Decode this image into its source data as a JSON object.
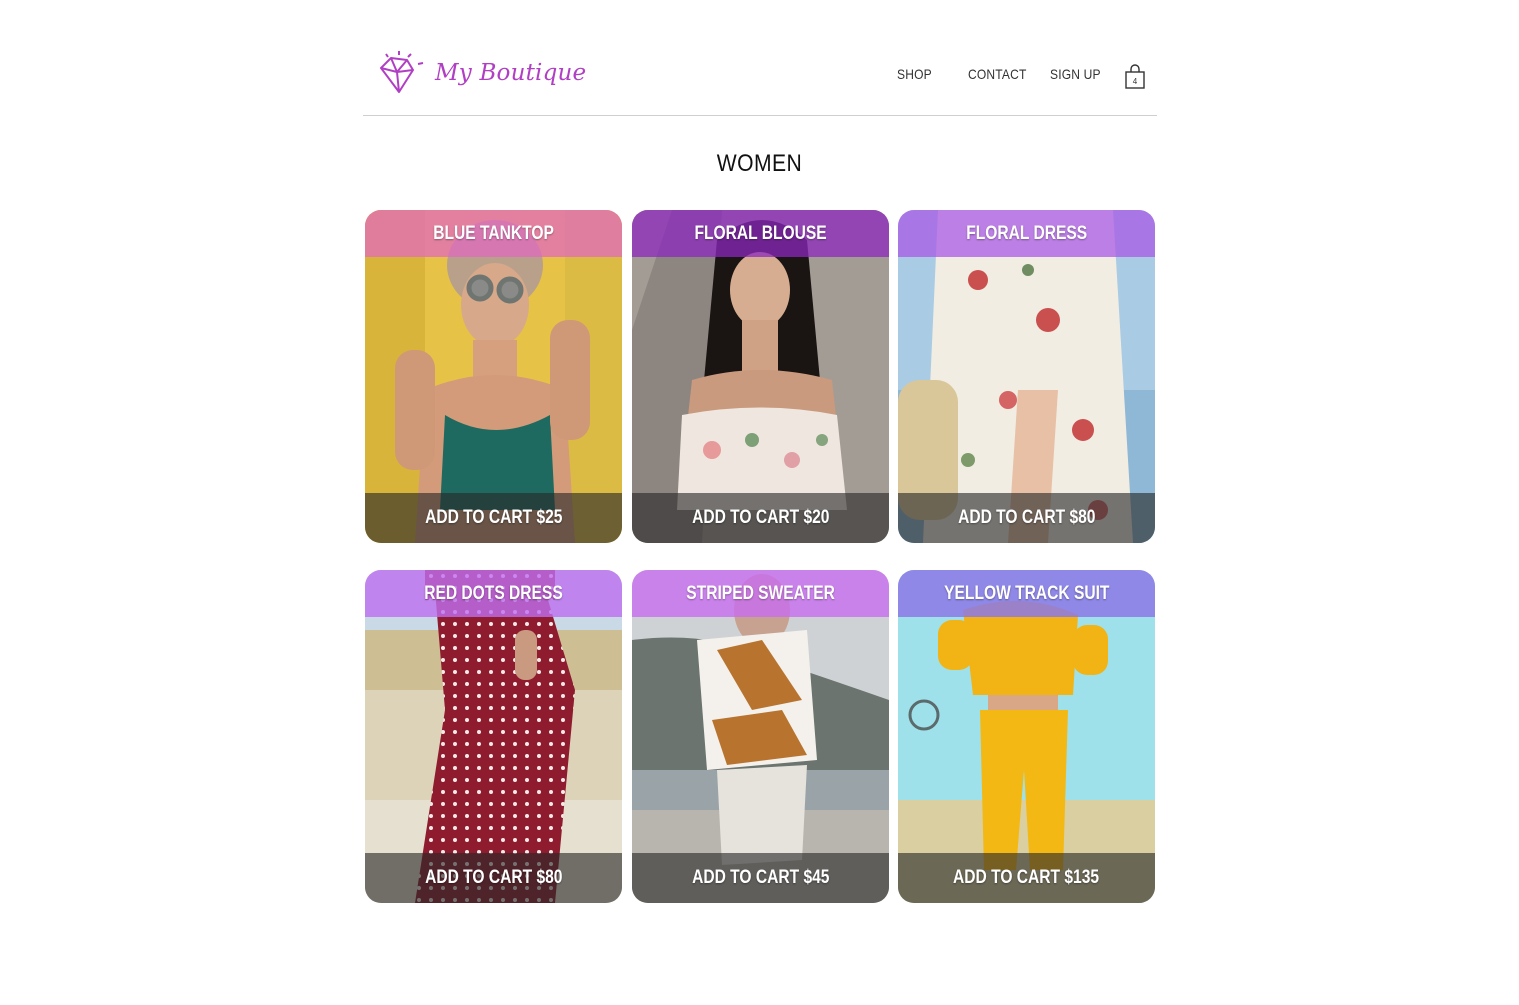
{
  "brand": {
    "name": "My Boutique",
    "logo_icon": "diamond-icon",
    "accent": "#b03fc4"
  },
  "nav": {
    "shop": "SHOP",
    "contact": "CONTACT",
    "sign_up": "SIGN UP",
    "cart_icon": "shopping-bag-icon",
    "cart_count": "4"
  },
  "page": {
    "title": "WOMEN"
  },
  "products": [
    {
      "name": "BLUE TANKTOP",
      "action": "ADD TO CART $25",
      "band_color": "rgba(226,106,190,0.75)"
    },
    {
      "name": "FLORAL BLOUSE",
      "action": "ADD TO CART $20",
      "band_color": "rgba(140,40,190,0.75)"
    },
    {
      "name": "FLORAL DRESS",
      "action": "ADD TO CART $80",
      "band_color": "rgba(170,90,230,0.75)"
    },
    {
      "name": "RED DOTS DRESS",
      "action": "ADD TO CART $80",
      "band_color": "rgba(190,110,240,0.8)"
    },
    {
      "name": "STRIPED SWEATER",
      "action": "ADD TO CART $45",
      "band_color": "rgba(200,110,240,0.8)"
    },
    {
      "name": "YELLOW TRACK SUIT",
      "action": "ADD TO CART $135",
      "band_color": "rgba(140,120,230,0.85)"
    }
  ]
}
